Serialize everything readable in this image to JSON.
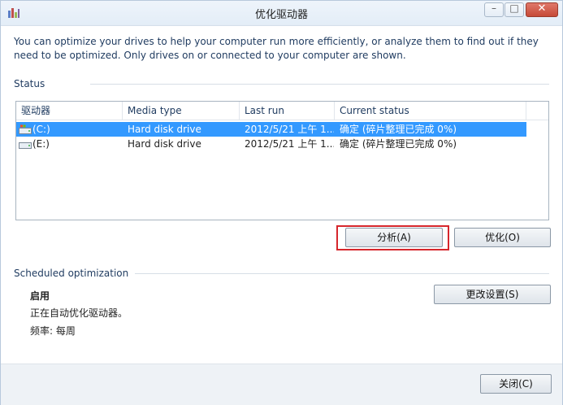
{
  "window": {
    "title": "优化驱动器"
  },
  "description": "You can optimize your drives to help your computer run more efficiently, or analyze them to find out if they need to be optimized. Only drives on or connected to your computer are shown.",
  "status_section": {
    "label": "Status",
    "columns": [
      "驱动器",
      "Media type",
      "Last run",
      "Current status"
    ],
    "rows": [
      {
        "drive": "(C:)",
        "media_type": "Hard disk drive",
        "last_run": "2012/5/21 上午 1...",
        "status": "确定 (碎片整理已完成 0%)",
        "selected": true
      },
      {
        "drive": "(E:)",
        "media_type": "Hard disk drive",
        "last_run": "2012/5/21 上午 1...",
        "status": "确定 (碎片整理已完成 0%)",
        "selected": false
      }
    ],
    "analyze_label": "分析(A)",
    "optimize_label": "优化(O)"
  },
  "scheduled_section": {
    "label": "Scheduled optimization",
    "state": "启用",
    "detail": "正在自动优化驱动器。",
    "frequency": "频率: 每周",
    "change_settings_label": "更改设置(S)"
  },
  "footer": {
    "close_label": "关闭(C)"
  },
  "colors": {
    "selection": "#3399ff",
    "highlight_box": "#d6262c",
    "label_text": "#1e3a5f"
  }
}
